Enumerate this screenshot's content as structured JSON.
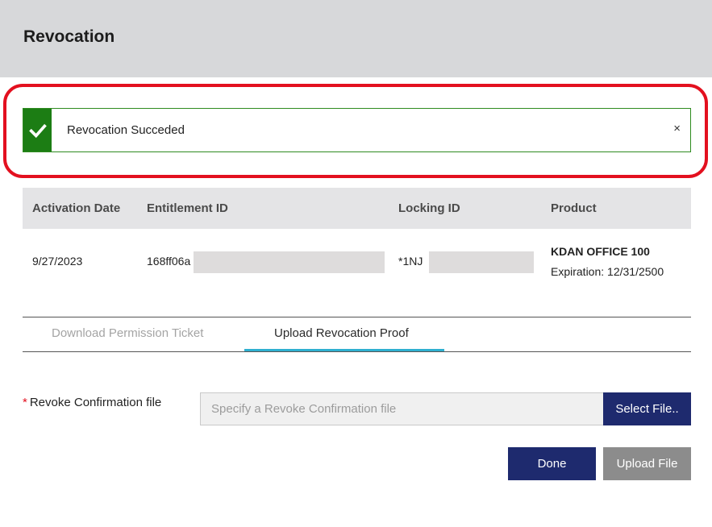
{
  "dialog": {
    "title": "Revocation"
  },
  "alert": {
    "message": "Revocation Succeded",
    "close_glyph": "×",
    "icon": "checkmark-icon",
    "color": "#1c7d14"
  },
  "table": {
    "headers": [
      "Activation Date",
      "Entitlement ID",
      "Locking ID",
      "Product"
    ],
    "row": {
      "activation_date": "9/27/2023",
      "entitlement_id": "168ff06a",
      "locking_id": "*1NJ",
      "product_name": "KDAN OFFICE 100",
      "product_expiration": "Expiration: 12/31/2500"
    }
  },
  "tabs": [
    {
      "label": "Download Permission Ticket",
      "active": false
    },
    {
      "label": "Upload Revocation Proof",
      "active": true
    }
  ],
  "upload": {
    "required_marker": "*",
    "label": "Revoke Confirmation file",
    "placeholder": "Specify a Revoke Confirmation file",
    "select_button": "Select File.."
  },
  "actions": {
    "done": "Done",
    "upload_file": "Upload File"
  },
  "colors": {
    "primary_button": "#1e2a6e",
    "disabled_button": "#8c8c8c",
    "highlight_ring": "#e3101f",
    "active_tab_accent": "#2fb0d0"
  }
}
